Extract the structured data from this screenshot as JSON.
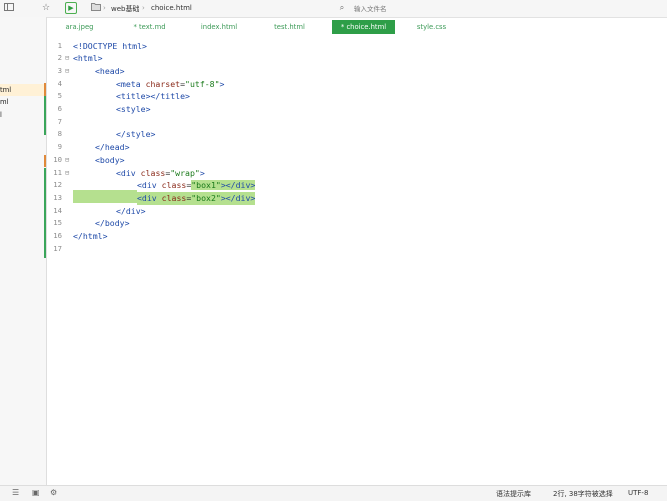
{
  "toolbar": {
    "icons": [
      "sidebar-toggle-icon",
      "star-icon",
      "run-icon",
      "folder-icon"
    ],
    "breadcrumb": [
      "web基础",
      "choice.html"
    ],
    "search_placeholder": "输入文件名"
  },
  "tabs": [
    {
      "label": "ara.jpeg",
      "active": false
    },
    {
      "label": "* text.md",
      "active": false
    },
    {
      "label": "index.html",
      "active": false
    },
    {
      "label": "test.html",
      "active": false
    },
    {
      "label": "* choice.html",
      "active": true
    },
    {
      "label": "style.css",
      "active": false
    }
  ],
  "files": [
    "tml",
    "ml",
    "l"
  ],
  "line_numbers": [
    "1",
    "2",
    "3",
    "4",
    "5",
    "6",
    "7",
    "8",
    "9",
    "10",
    "11",
    "12",
    "13",
    "14",
    "15",
    "16",
    "17"
  ],
  "code": {
    "l1": "<!DOCTYPE html>",
    "l2": "<html>",
    "l3": "<head>",
    "l4_tag": "<meta ",
    "l4_attr": "charset",
    "l4_eq": "=",
    "l4_str": "\"utf-8\"",
    "l4_end": ">",
    "l5": "<title></title>",
    "l6": "<style>",
    "l8": "</style>",
    "l9": "</head>",
    "l10": "<body>",
    "l11_tag": "<div ",
    "l11_attr": "class",
    "l11_eq": "=",
    "l11_str": "\"wrap\"",
    "l11_end": ">",
    "l12_tag": "<div ",
    "l12_attr": "class",
    "l12_eq": "=",
    "l12_str": "\"box1\"",
    "l12_end": "></div>",
    "l13_tag": "<div ",
    "l13_attr": "class",
    "l13_eq": "=",
    "l13_str": "\"box2\"",
    "l13_end": "></div>",
    "l14": "</div>",
    "l15": "</body>",
    "l16": "</html>"
  },
  "status": {
    "syntax": "语法提示库",
    "selection": "2行, 38字符被选择",
    "encoding": "UTF-8"
  },
  "colors": {
    "accent": "#2e9e48",
    "highlight": "#b5e08f",
    "modified_mark": "#e0893a",
    "saved_mark": "#3aa55a"
  }
}
